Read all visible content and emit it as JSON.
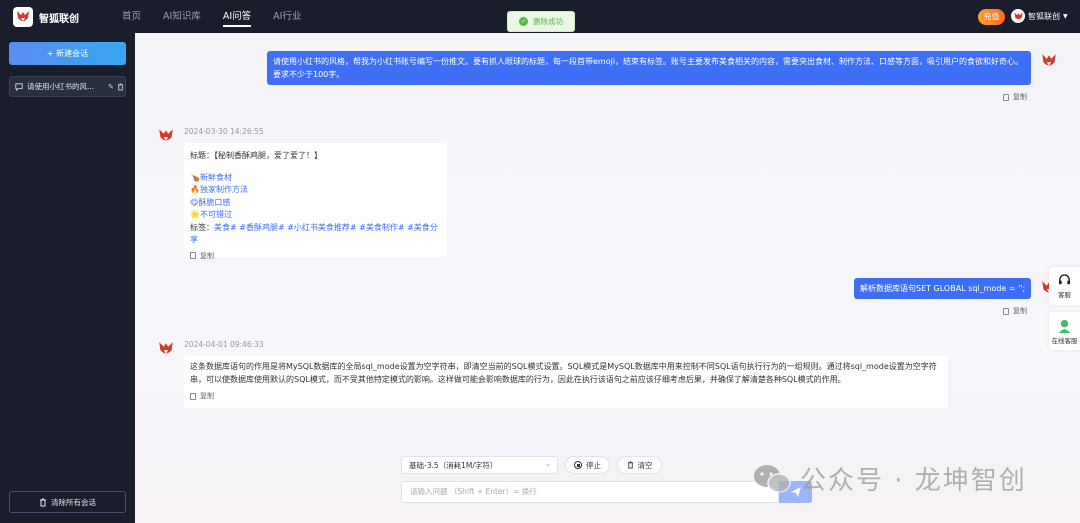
{
  "app": {
    "name": "智狐联创"
  },
  "nav": {
    "items": [
      {
        "label": "首页",
        "active": false
      },
      {
        "label": "AI知识库",
        "active": false
      },
      {
        "label": "AI问答",
        "active": true
      },
      {
        "label": "AI行业",
        "active": false
      }
    ]
  },
  "header": {
    "recharge_label": "充值",
    "user_name": "智狐联创"
  },
  "toast": {
    "text": "删除成功"
  },
  "sidebar": {
    "new_chat_label": "+ 新建会话",
    "conversations": [
      {
        "title": "请使用小红书的风..."
      }
    ],
    "clear_all_label": "清除所有会话"
  },
  "chat": {
    "messages": [
      {
        "role": "user",
        "text": "请使用小红书的风格，帮我为小红书账号编写一份推文。要有抓人眼球的标题，每一段首带emoji，结束有标签。账号主要发布美食相关的内容，需要突出食材、制作方法、口感等方面，吸引用户的食欲和好奇心。要求不少于100字。",
        "copy_label": "复制"
      },
      {
        "role": "bot",
        "timestamp": "2024-03-30 14:26:55",
        "title_line": "标题：【秘制香酥鸡腿，爱了爱了！】",
        "items": [
          "🍗新鲜食材",
          "🔥独家制作方法",
          "😋酥脆口感",
          "🌟不可错过"
        ],
        "tags_prefix": "标签：",
        "tags": "美食# #香酥鸡腿# #小红书美食推荐# #美食制作# #美食分享",
        "copy_label": "复制"
      },
      {
        "role": "user",
        "text": "解析数据库语句SET GLOBAL sql_mode = '';",
        "copy_label": "复制"
      },
      {
        "role": "bot",
        "timestamp": "2024-04-01 09:46:33",
        "text": "这条数据库语句的作用是将MySQL数据库的全局sql_mode设置为空字符串，即清空当前的SQL模式设置。SQL模式是MySQL数据库中用来控制不同SQL语句执行行为的一组规则。通过将sql_mode设置为空字符串，可以使数据库使用默认的SQL模式，而不受其他特定模式的影响。这样做可能会影响数据库的行为，因此在执行该语句之前应该仔细考虑后果，并确保了解清楚各种SQL模式的作用。",
        "copy_label": "复制"
      }
    ]
  },
  "composer": {
    "model_label": "基础-3.5（消耗1M/字符）",
    "stop_label": "停止",
    "clear_label": "清空",
    "input_placeholder": "请输入问题 （Shift + Enter）= 换行"
  },
  "float": {
    "service_label": "客服",
    "online_label": "在线客服"
  },
  "watermark": {
    "text": "公众号 · 龙坤智创"
  },
  "colors": {
    "primary": "#3d6ef5",
    "sidebar": "#1a1d2b",
    "recharge": "#ff7a1f",
    "success": "#56b847"
  }
}
